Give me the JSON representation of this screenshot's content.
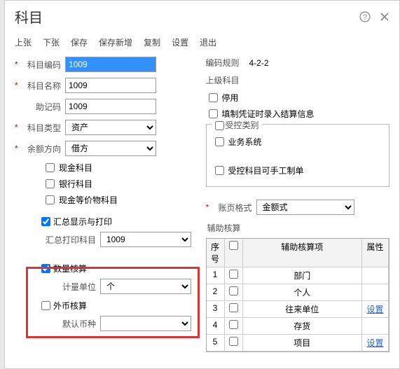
{
  "title": "科目",
  "toolbar": [
    "上张",
    "下张",
    "保存",
    "保存新增",
    "复制",
    "设置",
    "退出"
  ],
  "left": {
    "code_label": "科目编码",
    "code_value": "1009",
    "name_label": "科目名称",
    "name_value": "1009",
    "mnemonic_label": "助记码",
    "mnemonic_value": "1009",
    "type_label": "科目类型",
    "type_value": "资产",
    "balance_label": "余额方向",
    "balance_value": "借方",
    "cash_label": "现金科目",
    "bank_label": "银行科目",
    "casheq_label": "现金等价物科目",
    "summary_label": "汇总显示与打印",
    "summary_subject_label": "汇总打印科目",
    "summary_subject_value": "1009",
    "qty_label": "数量核算",
    "qty_unit_label": "计量单位",
    "qty_unit_value": "个",
    "fc_label": "外币核算",
    "fc_default_label": "默认币种"
  },
  "right": {
    "rule_label": "编码规则",
    "rule_value": "4-2-2",
    "parent_label": "上级科目",
    "disable_label": "停用",
    "settle_label": "填制凭证时录入结算信息",
    "controlled_legend": "受控类别",
    "biz_label": "业务系统",
    "manual_label": "受控科目可手工制单",
    "page_format_label": "账页格式",
    "page_format_value": "金额式",
    "aux_label": "辅助核算",
    "aux_head": {
      "seq": "序号",
      "chk": "",
      "item": "辅助核算项",
      "attr": "属性"
    },
    "aux_rows": [
      {
        "seq": "1",
        "item": "部门",
        "link": ""
      },
      {
        "seq": "2",
        "item": "个人",
        "link": ""
      },
      {
        "seq": "3",
        "item": "往来单位",
        "link": "设置"
      },
      {
        "seq": "4",
        "item": "存货",
        "link": ""
      },
      {
        "seq": "5",
        "item": "项目",
        "link": "设置"
      }
    ]
  }
}
